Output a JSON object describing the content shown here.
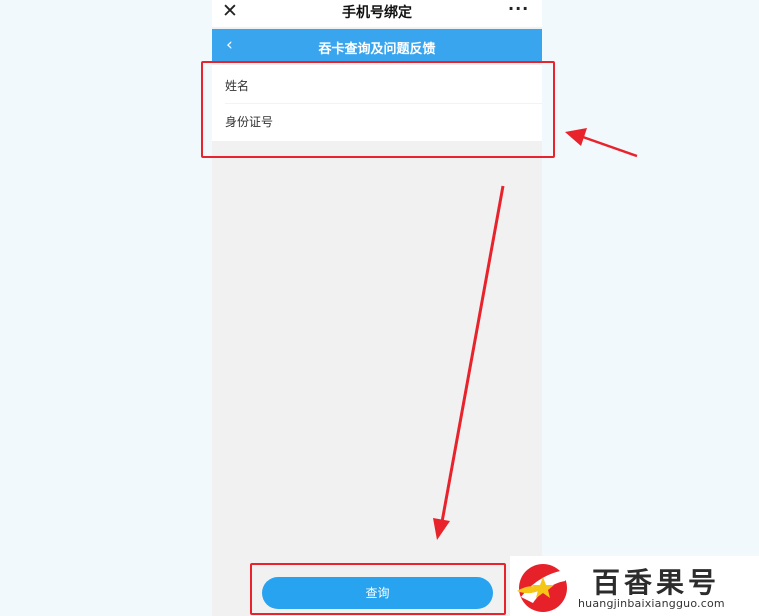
{
  "topbar": {
    "close_icon": "close-icon",
    "title": "手机号绑定",
    "more_label": "···"
  },
  "navbar": {
    "back_icon": "chevron-left-icon",
    "back_label": "‹",
    "title": "吞卡查询及问题反馈",
    "color": "#3aa5ef"
  },
  "form": {
    "name_label": "姓名",
    "id_label": "身份证号"
  },
  "actions": {
    "query_label": "查询",
    "color": "#28a3ef"
  },
  "annotation": {
    "color": "#e8232c"
  },
  "watermark": {
    "title": "百香果号",
    "url": "huangjinbaixiangguo.com"
  }
}
